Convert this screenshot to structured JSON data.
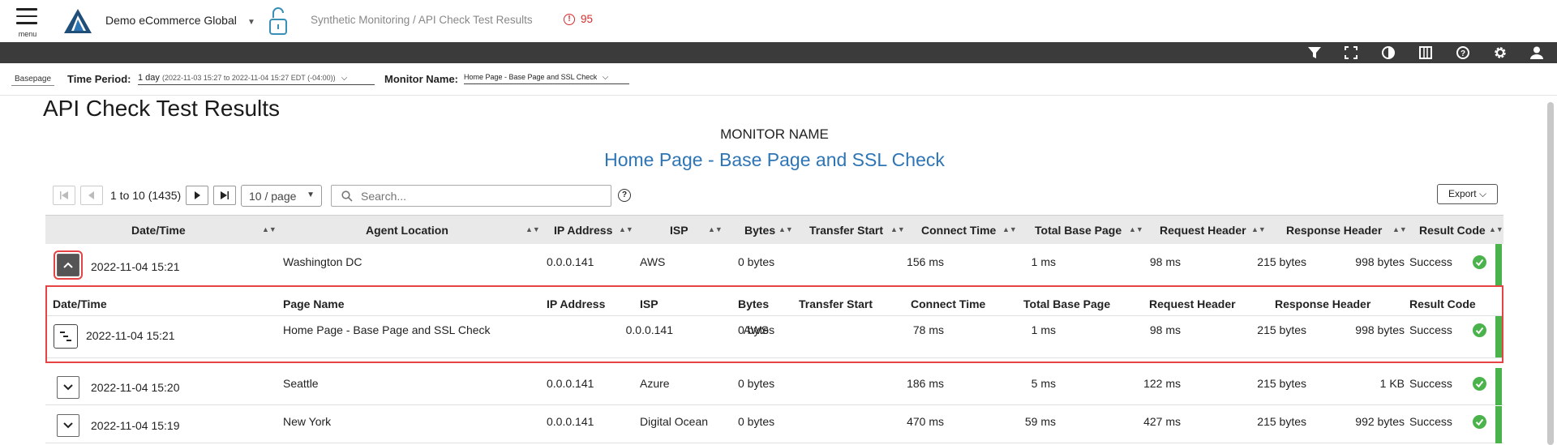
{
  "header": {
    "menu_label": "menu",
    "org_name": "Demo eCommerce Global",
    "breadcrumb": "Synthetic Monitoring / API Check Test Results",
    "alert_count": "95"
  },
  "filters": {
    "basepage_label": "Basepage",
    "time_period_label": "Time Period:",
    "time_period_value": "1 day",
    "time_period_range": "(2022-11-03 15:27 to 2022-11-04 15:27 EDT (-04:00))",
    "monitor_name_label": "Monitor Name:",
    "monitor_name_value": "Home Page - Base Page and SSL Check"
  },
  "page": {
    "title": "API Check Test Results",
    "monitor_label": "MONITOR NAME",
    "monitor_name": "Home Page - Base Page and SSL Check"
  },
  "pagination": {
    "range": "1 to 10 (1435)",
    "page_size": "10 / page",
    "search_placeholder": "Search...",
    "export_label": "Export"
  },
  "table": {
    "columns": [
      "Date/Time",
      "Agent Location",
      "IP Address",
      "ISP",
      "Bytes",
      "Transfer Start",
      "Connect Time",
      "Total Base Page",
      "Request Header",
      "Response Header",
      "Result Code"
    ],
    "rows": [
      {
        "datetime": "2022-11-04 15:21",
        "location": "Washington DC",
        "ip": "0.0.0.141",
        "isp": "AWS",
        "bytes": "0 bytes",
        "transfer": "156 ms",
        "connect": "1 ms",
        "total": "98 ms",
        "req": "215 bytes",
        "resp": "998 bytes",
        "result": "Success"
      },
      {
        "datetime": "2022-11-04 15:20",
        "location": "Seattle",
        "ip": "0.0.0.141",
        "isp": "Azure",
        "bytes": "0 bytes",
        "transfer": "186 ms",
        "connect": "5 ms",
        "total": "122 ms",
        "req": "215 bytes",
        "resp": "1 KB",
        "result": "Success"
      },
      {
        "datetime": "2022-11-04 15:19",
        "location": "New York",
        "ip": "0.0.0.141",
        "isp": "Digital Ocean",
        "bytes": "0 bytes",
        "transfer": "470 ms",
        "connect": "59 ms",
        "total": "427 ms",
        "req": "215 bytes",
        "resp": "992 bytes",
        "result": "Success"
      }
    ],
    "detail": {
      "columns": [
        "Date/Time",
        "Page Name",
        "IP Address",
        "ISP",
        "Bytes",
        "Transfer Start",
        "Connect Time",
        "Total Base Page",
        "Request Header",
        "Response Header",
        "Result Code"
      ],
      "row": {
        "datetime": "2022-11-04 15:21",
        "page": "Home Page - Base Page and SSL Check",
        "ip": "0.0.0.141",
        "isp": "AWS",
        "bytes": "0 bytes",
        "transfer": "78 ms",
        "connect": "1 ms",
        "total": "98 ms",
        "req": "215 bytes",
        "resp": "998 bytes",
        "result": "Success"
      }
    }
  },
  "colors": {
    "link_blue": "#2e75b6",
    "success_green": "#4bb34b",
    "alert_red": "#d62b2b",
    "toolbar_dark": "#3b3b3b"
  },
  "icons": [
    "menu-icon",
    "logo-icon",
    "unlock-icon",
    "alert-icon",
    "filter-icon",
    "fullscreen-icon",
    "contrast-icon",
    "columns-icon",
    "help-icon",
    "gear-icon",
    "user-icon",
    "search-icon",
    "chevron-up-icon",
    "chevron-down-icon",
    "waterfall-icon",
    "check-circle-icon"
  ]
}
